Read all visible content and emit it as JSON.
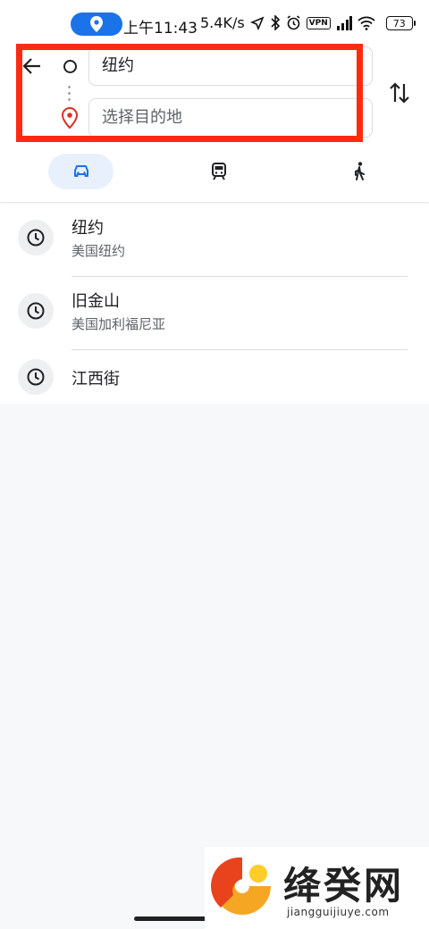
{
  "status": {
    "time": "上午11:43",
    "speed": "5.4K/s",
    "vpn": "VPN",
    "battery": "73"
  },
  "directions": {
    "start_value": "纽约",
    "destination_placeholder": "选择目的地"
  },
  "recents": [
    {
      "title": "纽约",
      "subtitle": "美国纽约"
    },
    {
      "title": "旧金山",
      "subtitle": "美国加利福尼亚"
    },
    {
      "title": "江西街",
      "subtitle": ""
    }
  ],
  "watermark": {
    "name": "绛癸网",
    "url": "jiangguijiuye.com"
  },
  "colors": {
    "accent": "#1a73e8",
    "highlight": "#ff2a10",
    "pin": "#d93025"
  }
}
